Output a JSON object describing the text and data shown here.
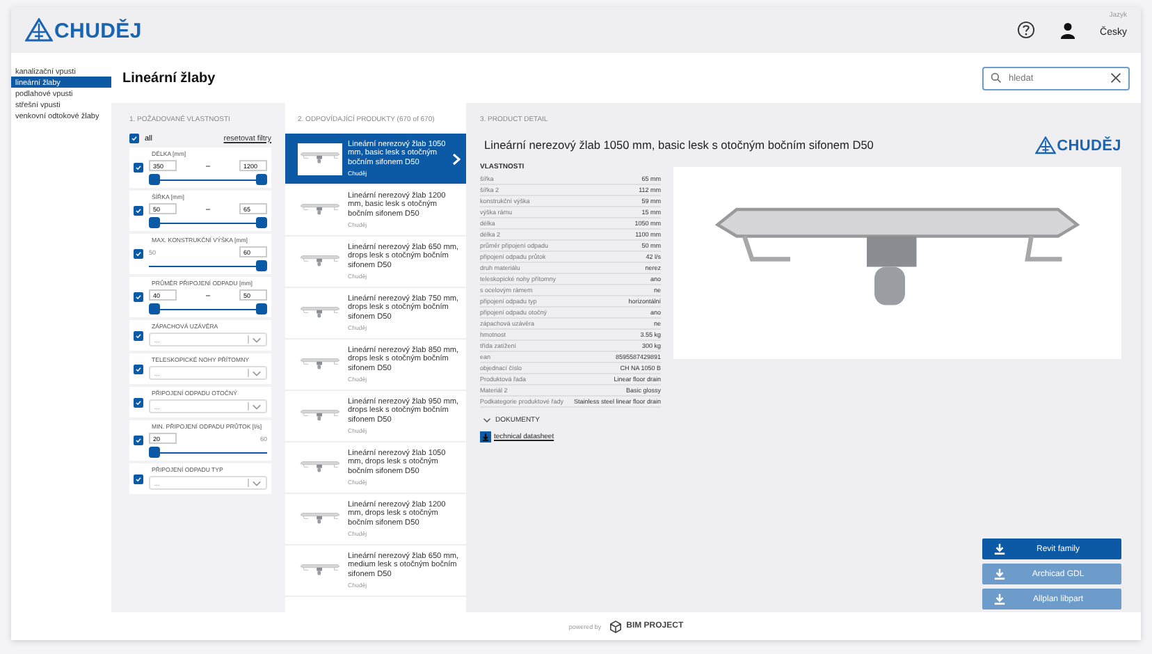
{
  "header": {
    "logo": "CHUDĚJ",
    "language_label": "Jazyk",
    "language": "Česky"
  },
  "nav": {
    "items": [
      {
        "label": "kanalizační vpusti",
        "selected": false
      },
      {
        "label": "lineární žlaby",
        "selected": true
      },
      {
        "label": "podlahové vpusti",
        "selected": false
      },
      {
        "label": "střešní vpusti",
        "selected": false
      },
      {
        "label": "venkovní odtokové žlaby",
        "selected": false
      }
    ]
  },
  "page_title": "Lineární žlaby",
  "search": {
    "placeholder": "hledat"
  },
  "filters": {
    "heading": "1. POŽADOVANÉ VLASTNOSTI",
    "all_label": "all",
    "all_checked": true,
    "reset": "resetovat filtry",
    "items": [
      {
        "kind": "range",
        "label": "DÉLKA [mm]",
        "checked": true,
        "from": "350",
        "to": "1200",
        "thumbs": [
          {
            "level": 0
          },
          {
            "level": 1
          }
        ]
      },
      {
        "kind": "range",
        "label": "ŠÍŘKA [mm]",
        "checked": true,
        "from": "50",
        "to": "65",
        "thumbs": [
          {
            "level": 0
          },
          {
            "level": 1
          }
        ]
      },
      {
        "kind": "max",
        "label": "MAX. KONSTRUKČNÍ VÝŠKA [mm]",
        "checked": true,
        "bound": "50",
        "value": "60",
        "level": 1
      },
      {
        "kind": "range",
        "label": "PRŮMĚR PŘIPOJENÍ ODPADU [mm]",
        "checked": true,
        "from": "40",
        "to": "50",
        "thumbs": [
          {
            "level": 0
          },
          {
            "level": 1
          }
        ]
      },
      {
        "kind": "select",
        "label": "ZÁPACHOVÁ UZÁVĚRA",
        "checked": true,
        "value": "..."
      },
      {
        "kind": "select",
        "label": "TELESKOPICKÉ NOHY PŘÍTOMNY",
        "checked": true,
        "value": "..."
      },
      {
        "kind": "select",
        "label": "PŘIPOJENÍ ODPADU OTOČNÝ",
        "checked": true,
        "value": "..."
      },
      {
        "kind": "min",
        "label": "MIN. PŘIPOJENÍ ODPADU PRŮTOK [l/s]",
        "checked": true,
        "value": "20",
        "bound": "60",
        "level": 0
      },
      {
        "kind": "select",
        "label": "PŘIPOJENÍ ODPADU TYP",
        "checked": true,
        "value": "..."
      }
    ]
  },
  "products": {
    "heading": "2. ODPOVÍDAJÍCÍ PRODUKTY (670 of 670)",
    "items": [
      {
        "name": "Lineární nerezový žlab 1050 mm, basic lesk s otočným bočním sifonem D50",
        "brand": "Chuděj",
        "selected": true
      },
      {
        "name": "Lineární nerezový žlab 1200 mm, basic lesk s otočným bočním sifonem D50",
        "brand": "Chuděj",
        "selected": false
      },
      {
        "name": "Lineární nerezový žlab 650 mm, drops lesk s otočným bočním sifonem D50",
        "brand": "Chuděj",
        "selected": false
      },
      {
        "name": "Lineární nerezový žlab 750 mm, drops lesk s otočným bočním sifonem D50",
        "brand": "Chuděj",
        "selected": false
      },
      {
        "name": "Lineární nerezový žlab 850 mm, drops lesk s otočným bočním sifonem D50",
        "brand": "Chuděj",
        "selected": false
      },
      {
        "name": "Lineární nerezový žlab 950 mm, drops lesk s otočným bočním sifonem D50",
        "brand": "Chuděj",
        "selected": false
      },
      {
        "name": "Lineární nerezový žlab 1050 mm, drops lesk s otočným bočním sifonem D50",
        "brand": "Chuděj",
        "selected": false
      },
      {
        "name": "Lineární nerezový žlab 1200 mm, drops lesk s otočným bočním sifonem D50",
        "brand": "Chuděj",
        "selected": false
      },
      {
        "name": "Lineární nerezový žlab 650 mm, medium lesk s otočným bočním sifonem D50",
        "brand": "Chuděj",
        "selected": false
      }
    ]
  },
  "detail": {
    "heading": "3. PRODUCT DETAIL",
    "title": "Lineární nerezový žlab 1050 mm, basic lesk s otočným bočním sifonem D50",
    "logo": "CHUDĚJ",
    "properties_heading": "VLASTNOSTI",
    "properties": [
      {
        "name": "šířka",
        "value": "65 mm"
      },
      {
        "name": "šířka 2",
        "value": "112 mm"
      },
      {
        "name": "konstrukční výška",
        "value": "59 mm"
      },
      {
        "name": "výška rámu",
        "value": "15 mm"
      },
      {
        "name": "délka",
        "value": "1050 mm"
      },
      {
        "name": "délka 2",
        "value": "1100 mm"
      },
      {
        "name": "průměr připojení odpadu",
        "value": "50 mm"
      },
      {
        "name": "připojení odpadu průtok",
        "value": "42 l/s"
      },
      {
        "name": "druh materiálu",
        "value": "nerez"
      },
      {
        "name": "teleskopické nohy přítomny",
        "value": "ano"
      },
      {
        "name": "s ocelovým rámem",
        "value": "ne"
      },
      {
        "name": "připojení odpadu typ",
        "value": "horizontální"
      },
      {
        "name": "připojení odpadu otočný",
        "value": "ano"
      },
      {
        "name": "zápachová uzávěra",
        "value": "ne"
      },
      {
        "name": "hmotnost",
        "value": "3.55 kg"
      },
      {
        "name": "třída zatížení",
        "value": "300 kg"
      },
      {
        "name": "ean",
        "value": "8595587429891"
      },
      {
        "name": "objednací číslo",
        "value": "CH NA 1050 B"
      },
      {
        "name": "Produktová řada",
        "value": "Linear floor drain"
      },
      {
        "name": "Materiál 2",
        "value": "Basic glossy"
      },
      {
        "name": "Podkategorie produktové řady",
        "value": "Stainless steel linear floor drain"
      }
    ],
    "documents_heading": "DOKUMENTY",
    "documents_expanded": true,
    "documents": [
      {
        "label": "technical datasheet"
      }
    ],
    "downloads": [
      {
        "label": "Revit family",
        "disabled": false
      },
      {
        "label": "Archicad GDL",
        "disabled": true
      },
      {
        "label": "Allplan libpart",
        "disabled": true
      }
    ]
  },
  "footer": {
    "powered_by": "powered by",
    "brand": "BIM PROJECT"
  }
}
